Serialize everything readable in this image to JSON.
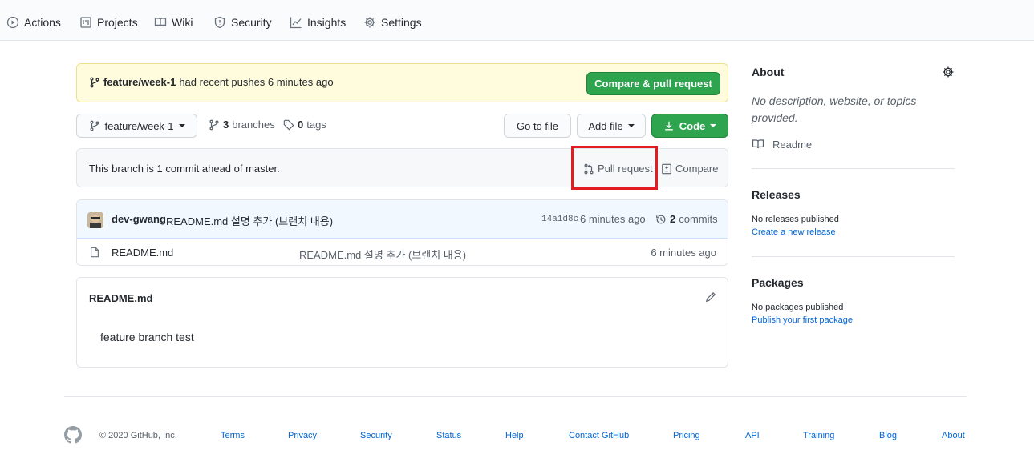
{
  "nav": {
    "tabs": [
      {
        "label": "Actions",
        "icon": "play-circle-icon"
      },
      {
        "label": "Projects",
        "icon": "project-icon"
      },
      {
        "label": "Wiki",
        "icon": "book-icon"
      },
      {
        "label": "Security",
        "icon": "shield-icon"
      },
      {
        "label": "Insights",
        "icon": "graph-icon"
      },
      {
        "label": "Settings",
        "icon": "gear-icon"
      }
    ]
  },
  "banner": {
    "branch": "feature/week-1",
    "message": "had recent pushes 6 minutes ago",
    "button": "Compare & pull request"
  },
  "toolbar": {
    "branch": "feature/week-1",
    "branches_count": "3",
    "branches_label": "branches",
    "tags_count": "0",
    "tags_label": "tags",
    "go_to_file": "Go to file",
    "add_file": "Add file",
    "code": "Code"
  },
  "ahead": {
    "message": "This branch is 1 commit ahead of master.",
    "pull_request": "Pull request",
    "compare": "Compare"
  },
  "commit": {
    "author": "dev-gwang",
    "message": "README.md 설명 추가 (브랜치 내용)",
    "sha": "14a1d8c",
    "time": "6 minutes ago",
    "commits_count": "2",
    "commits_label": "commits"
  },
  "files": [
    {
      "name": "README.md",
      "message": "README.md 설명 추가 (브랜치 내용)",
      "time": "6 minutes ago"
    }
  ],
  "readme": {
    "title": "README.md",
    "content": "feature branch test"
  },
  "sidebar": {
    "about_title": "About",
    "about_desc": "No description, website, or topics provided.",
    "readme_link": "Readme",
    "releases_title": "Releases",
    "releases_empty": "No releases published",
    "releases_link": "Create a new release",
    "packages_title": "Packages",
    "packages_empty": "No packages published",
    "packages_link": "Publish your first package"
  },
  "footer": {
    "copyright": "© 2020 GitHub, Inc.",
    "links": [
      "Terms",
      "Privacy",
      "Security",
      "Status",
      "Help",
      "Contact GitHub",
      "Pricing",
      "API",
      "Training",
      "Blog",
      "About"
    ]
  },
  "colors": {
    "green": "#2ea44f",
    "link_blue": "#0366d6",
    "highlight_red": "#e11d21",
    "banner_yellow": "#fffbdd"
  }
}
